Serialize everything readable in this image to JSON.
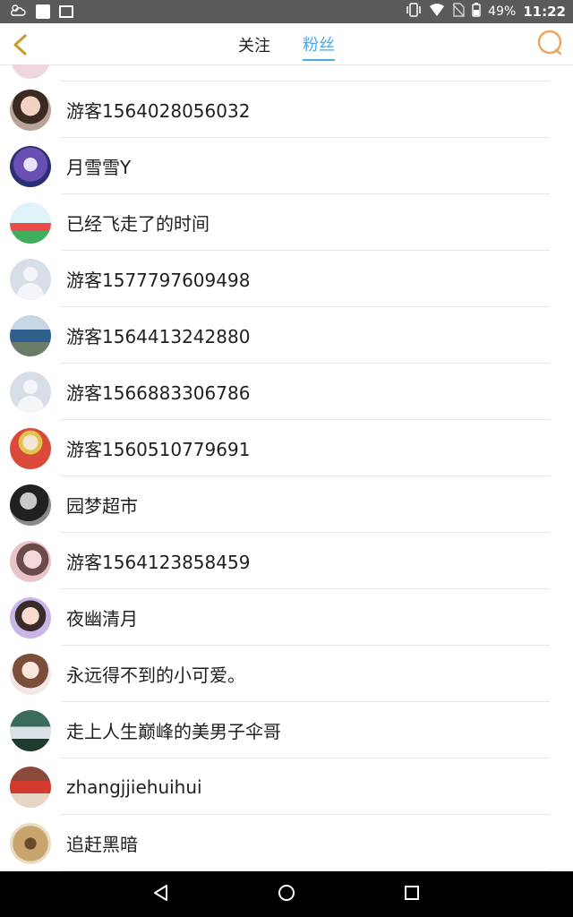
{
  "status_bar": {
    "battery": "49%",
    "time": "11:22"
  },
  "header": {
    "tabs": [
      {
        "label": "关注",
        "active": false
      },
      {
        "label": "粉丝",
        "active": true
      }
    ],
    "accent_color": "#4aa8e6",
    "icon_color": "#f0a35a"
  },
  "followers": [
    {
      "name": "游客1564028056032",
      "avatar": "girl-photo"
    },
    {
      "name": "月雪雪Y",
      "avatar": "anime-character"
    },
    {
      "name": "已经飞走了的时间",
      "avatar": "watermelon-cartoon"
    },
    {
      "name": "游客1577797609498",
      "avatar": "default-avatar"
    },
    {
      "name": "游客1564413242880",
      "avatar": "seaside-photo"
    },
    {
      "name": "游客1566883306786",
      "avatar": "default-avatar"
    },
    {
      "name": "游客1560510779691",
      "avatar": "person-red-shirt"
    },
    {
      "name": "园梦超市",
      "avatar": "black-white-photo"
    },
    {
      "name": "游客1564123858459",
      "avatar": "girl-pink-photo"
    },
    {
      "name": "夜幽清月",
      "avatar": "child-photo"
    },
    {
      "name": "永远得不到的小可爱。",
      "avatar": "cartoon-girl"
    },
    {
      "name": "走上人生巅峰的美男子伞哥",
      "avatar": "car-photo"
    },
    {
      "name": "zhangjjiehuihui",
      "avatar": "red-vintage-car"
    },
    {
      "name": "追赶黑暗",
      "avatar": "basket-photo"
    }
  ]
}
